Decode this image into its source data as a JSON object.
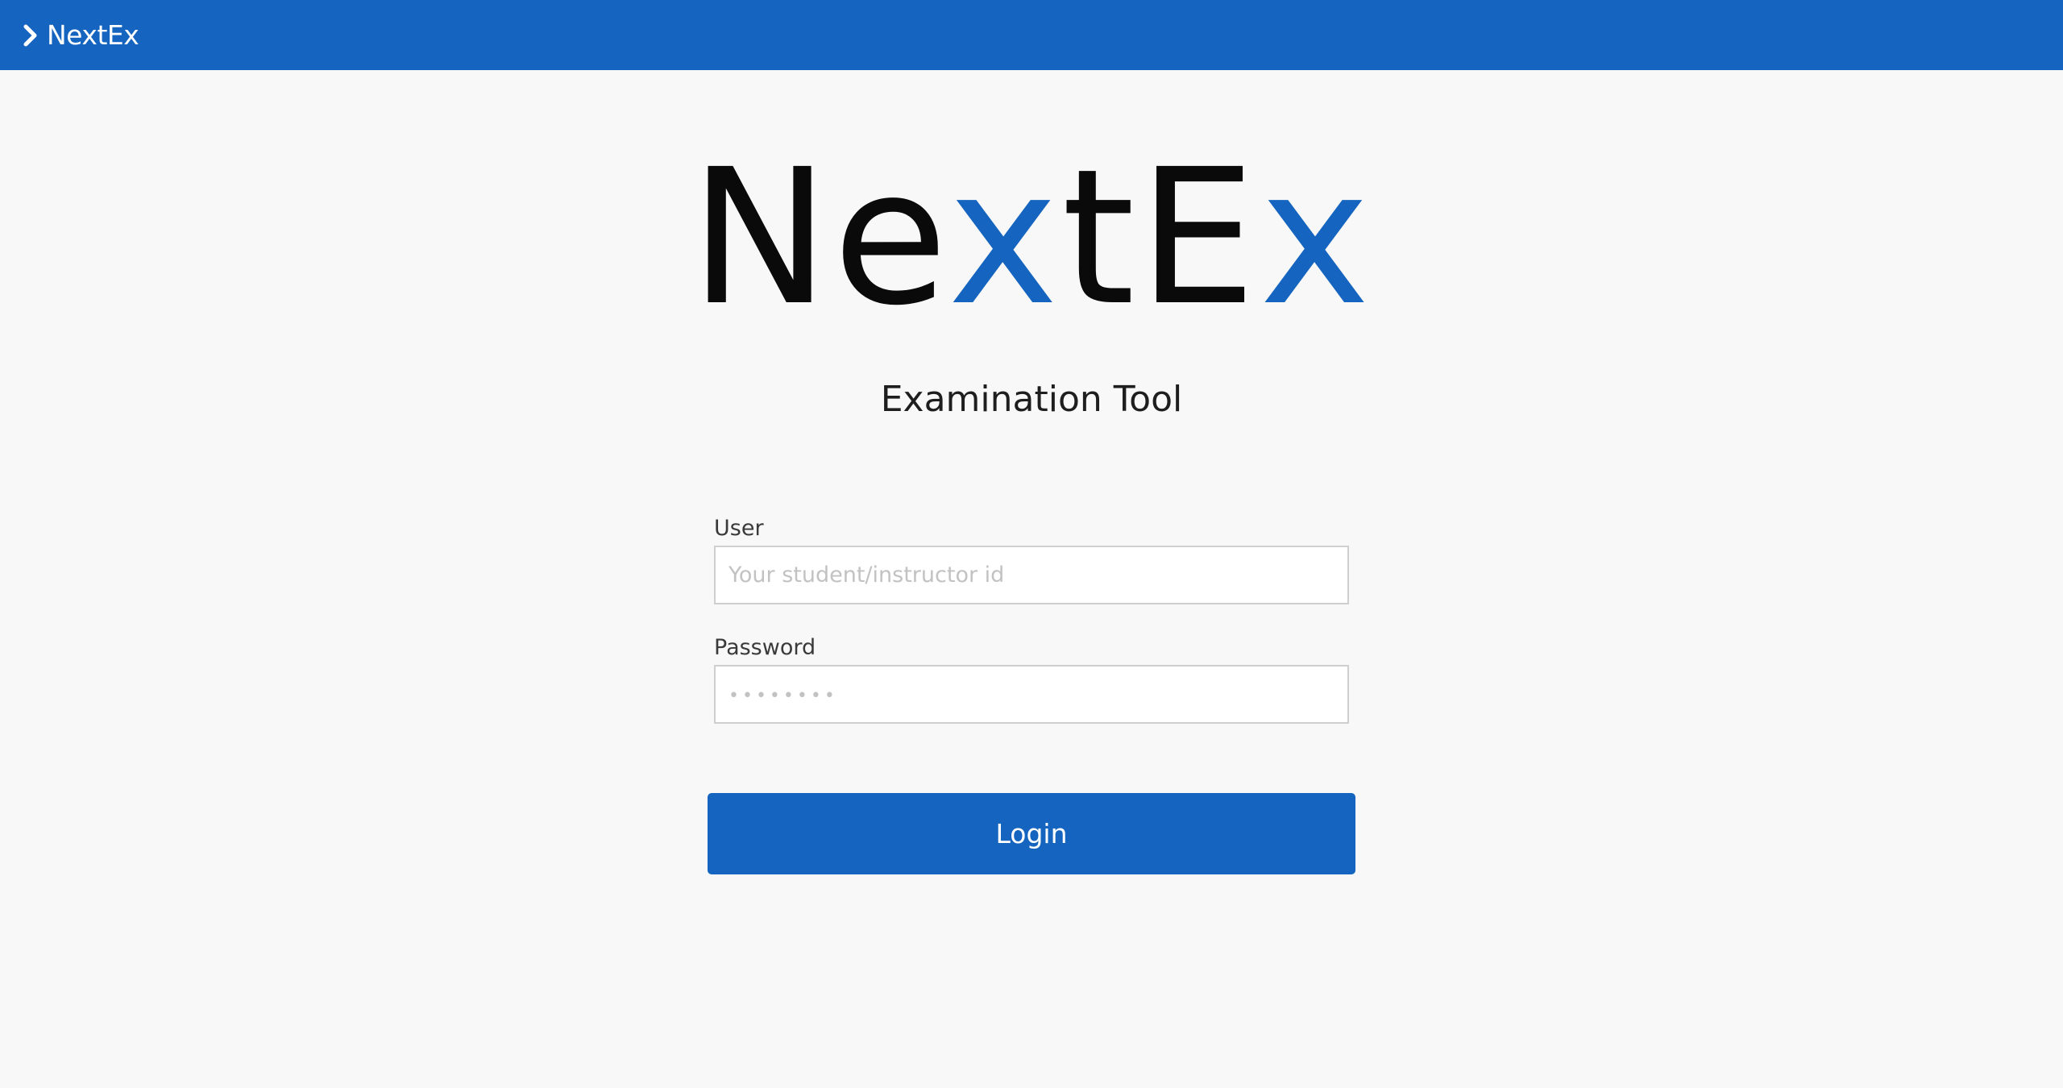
{
  "header": {
    "brand_label": "NextEx",
    "brand_icon": "chevron-right-icon",
    "background_color": "#1565c0"
  },
  "logo": {
    "part_1": "Ne",
    "part_2": "x",
    "part_3": "tE",
    "part_4": "x",
    "dark_color": "#0a0a0a",
    "accent_color": "#1565c0"
  },
  "subtitle": "Examination Tool",
  "form": {
    "user": {
      "label": "User",
      "value": "",
      "placeholder": "Your student/instructor id"
    },
    "password": {
      "label": "Password",
      "value": "",
      "placeholder": "••••••••"
    },
    "login_label": "Login"
  }
}
